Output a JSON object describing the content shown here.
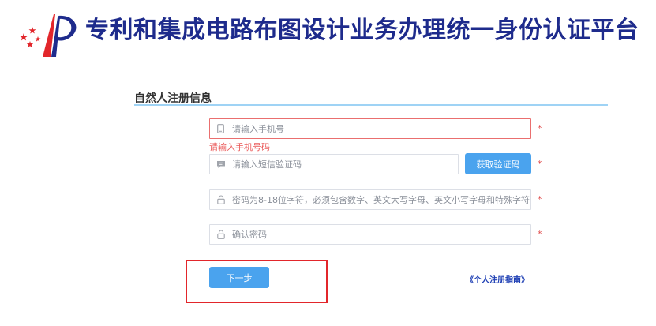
{
  "header": {
    "site_title": "专利和集成电路布图设计业务办理统一身份认证平台",
    "logo": "cnipa-logo"
  },
  "section": {
    "title": "自然人注册信息"
  },
  "form": {
    "phone": {
      "placeholder": "请输入手机号",
      "value": "",
      "icon": "phone-icon",
      "required_mark": "*",
      "error": "请输入手机号码"
    },
    "sms_code": {
      "placeholder": "请输入短信验证码",
      "value": "",
      "icon": "message-icon",
      "required_mark": "*",
      "button_label": "获取验证码"
    },
    "password": {
      "placeholder": "密码为8-18位字符，必须包含数字、英文大写字母、英文小写字母和特殊字符",
      "value": "",
      "icon": "lock-icon",
      "required_mark": "*"
    },
    "confirm_password": {
      "placeholder": "确认密码",
      "value": "",
      "icon": "lock-icon",
      "required_mark": "*"
    }
  },
  "actions": {
    "next_label": "下一步",
    "guide_link": "《个人注册指南》"
  },
  "colors": {
    "title": "#1e2b8c",
    "primary_button": "#4aa3ee",
    "error": "#ea5a5a",
    "highlight": "#e2262b",
    "section_rule": "#9fd3f5"
  }
}
